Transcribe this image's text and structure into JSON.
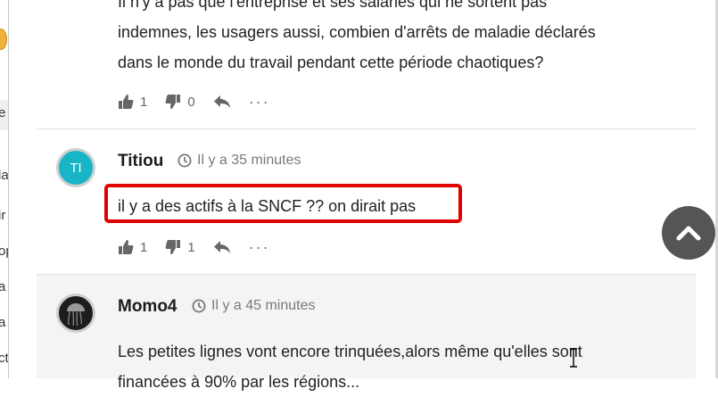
{
  "sidebar_fragments": [
    "e",
    "la",
    "ir",
    "op",
    "a",
    "a",
    "ct"
  ],
  "comments": [
    {
      "text_lines": [
        "Il n'y a pas que l'entreprise et ses salariés qui ne sortent pas",
        "indemnes, les usagers aussi, combien d'arrêts de maladie déclarés",
        "dans le monde du travail pendant cette période chaotiques?"
      ],
      "likes": "1",
      "dislikes": "0"
    },
    {
      "author": "Titiou",
      "avatar_initials": "TI",
      "avatar_color": "#17b5c6",
      "timestamp": "Il y a 35 minutes",
      "text": "il y a des actifs à la SNCF ?? on dirait pas",
      "likes": "1",
      "dislikes": "1"
    },
    {
      "author": "Momo4",
      "timestamp": "Il y a 45 minutes",
      "text_lines": [
        "Les petites lignes vont encore trinquées,alors même qu'elles sont",
        "financées à 90% par les régions..."
      ]
    }
  ],
  "icons": {
    "like": "thumbs-up-icon",
    "dislike": "thumbs-down-icon",
    "reply": "reply-icon",
    "more": "more-icon",
    "clock": "clock-icon",
    "scroll_top": "chevron-up-icon"
  },
  "colors": {
    "highlight": "#e00000",
    "scroll_button": "#555555",
    "active_comment_bg": "#f4f4f4"
  }
}
